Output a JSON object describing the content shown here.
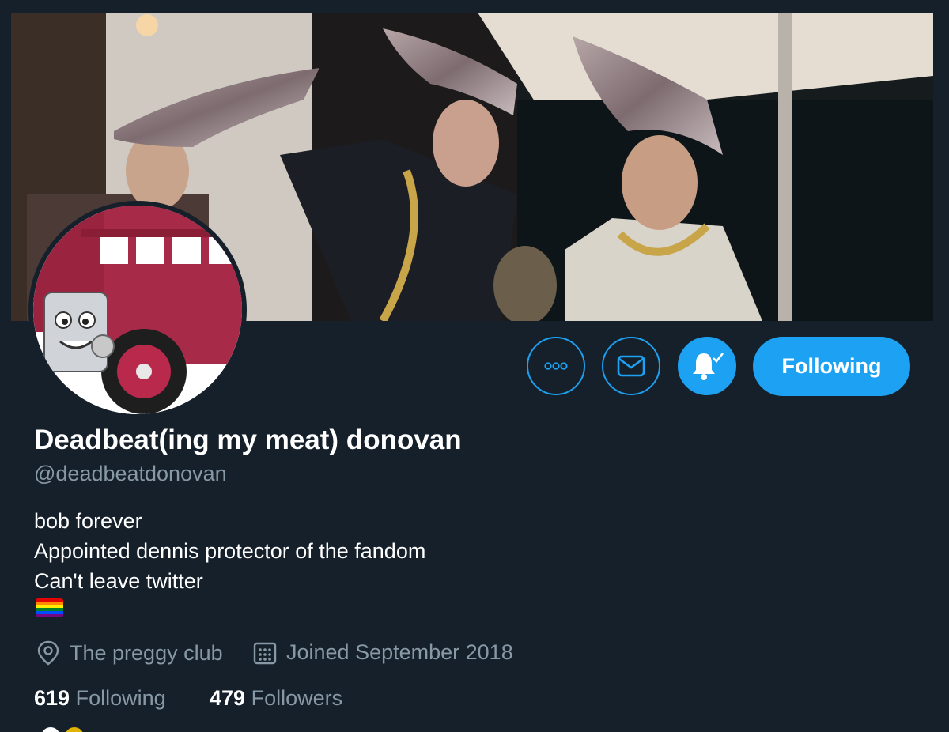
{
  "profile": {
    "display_name": "Deadbeat(ing my meat) donovan",
    "handle": "@deadbeatdonovan",
    "bio_lines": [
      "bob forever",
      "Appointed dennis protector of the fandom",
      "Can't leave twitter"
    ],
    "bio_emoji": "rainbow-flag",
    "location": "The preggy club",
    "joined": "Joined September 2018"
  },
  "stats": {
    "following_count": "619",
    "following_label": "Following",
    "followers_count": "479",
    "followers_label": "Followers"
  },
  "actions": {
    "more_icon": "more-dots-icon",
    "message_icon": "envelope-icon",
    "notify_icon": "bell-check-icon",
    "following_button": "Following"
  },
  "colors": {
    "background": "#15202b",
    "accent": "#1da1f2",
    "secondary_text": "#8899a6",
    "primary_text": "#ffffff"
  }
}
